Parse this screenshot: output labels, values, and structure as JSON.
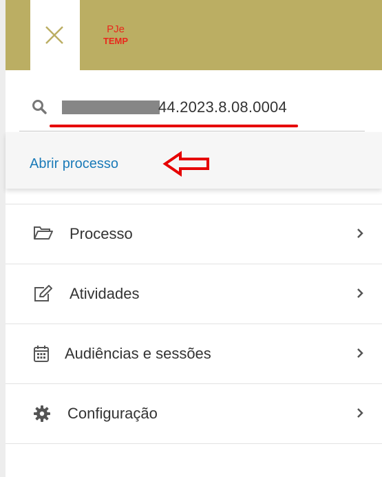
{
  "header": {
    "logo_line1": "PJe",
    "logo_line2": "TEMP",
    "accent_color": "#bbae63",
    "close_icon": "close-icon"
  },
  "search": {
    "value_visible": "44.2023.8.08.0004",
    "icon": "search-icon"
  },
  "open_process": {
    "label": "Abrir processo",
    "annotation_arrow": "left-arrow-icon"
  },
  "menu": {
    "items": [
      {
        "label": "Processo",
        "icon": "folder-open-icon"
      },
      {
        "label": "Atividades",
        "icon": "edit-icon"
      },
      {
        "label": "Audiências e sessões",
        "icon": "calendar-icon"
      },
      {
        "label": "Configuração",
        "icon": "gear-icon"
      }
    ]
  }
}
